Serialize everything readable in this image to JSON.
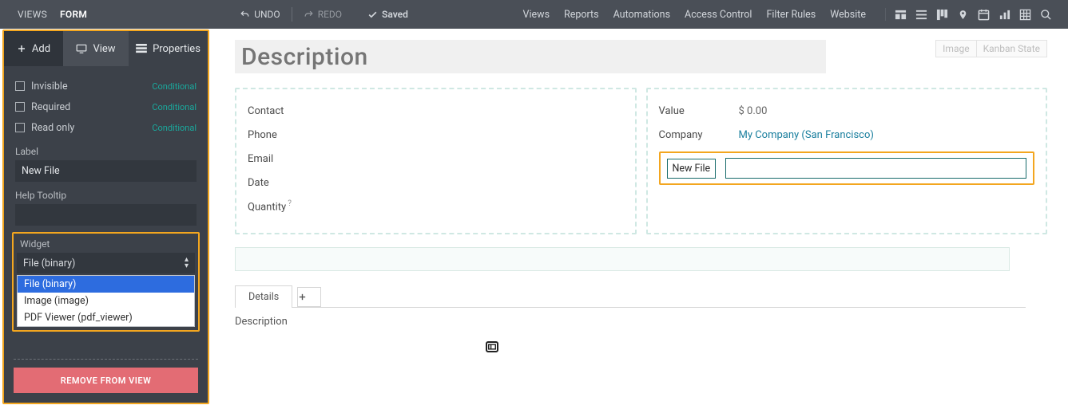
{
  "colors": {
    "accent_teal": "#176b6b",
    "highlight": "#f3a61f",
    "danger": "#e36c74"
  },
  "topbar": {
    "modes": {
      "views": "VIEWS",
      "form": "FORM"
    },
    "undo": "UNDO",
    "redo": "REDO",
    "saved": "Saved",
    "nav": {
      "views": "Views",
      "reports": "Reports",
      "automations": "Automations",
      "access": "Access Control",
      "filter": "Filter Rules",
      "website": "Website"
    }
  },
  "sidebar": {
    "tabs": {
      "add": "Add",
      "view": "View",
      "properties": "Properties"
    },
    "props": {
      "invisible": "Invisible",
      "required": "Required",
      "readonly": "Read only",
      "conditional": "Conditional"
    },
    "label_field_label": "Label",
    "label_value": "New File",
    "help_label": "Help Tooltip",
    "help_value": "",
    "widget_label": "Widget",
    "widget_selected": "File (binary)",
    "widget_options": [
      "File (binary)",
      "Image (image)",
      "PDF Viewer (pdf_viewer)"
    ],
    "remove": "REMOVE FROM VIEW"
  },
  "main": {
    "title_placeholder": "Description",
    "corner": {
      "image": "Image",
      "kanban": "Kanban State"
    },
    "left_fields": {
      "contact": "Contact",
      "phone": "Phone",
      "email": "Email",
      "date": "Date",
      "quantity": "Quantity"
    },
    "right_fields": {
      "value_label": "Value",
      "value_val": "$ 0.00",
      "company_label": "Company",
      "company_val": "My Company (San Francisco)",
      "newfile_label": "New File"
    },
    "tabs": {
      "details": "Details"
    },
    "desc_label": "Description"
  }
}
